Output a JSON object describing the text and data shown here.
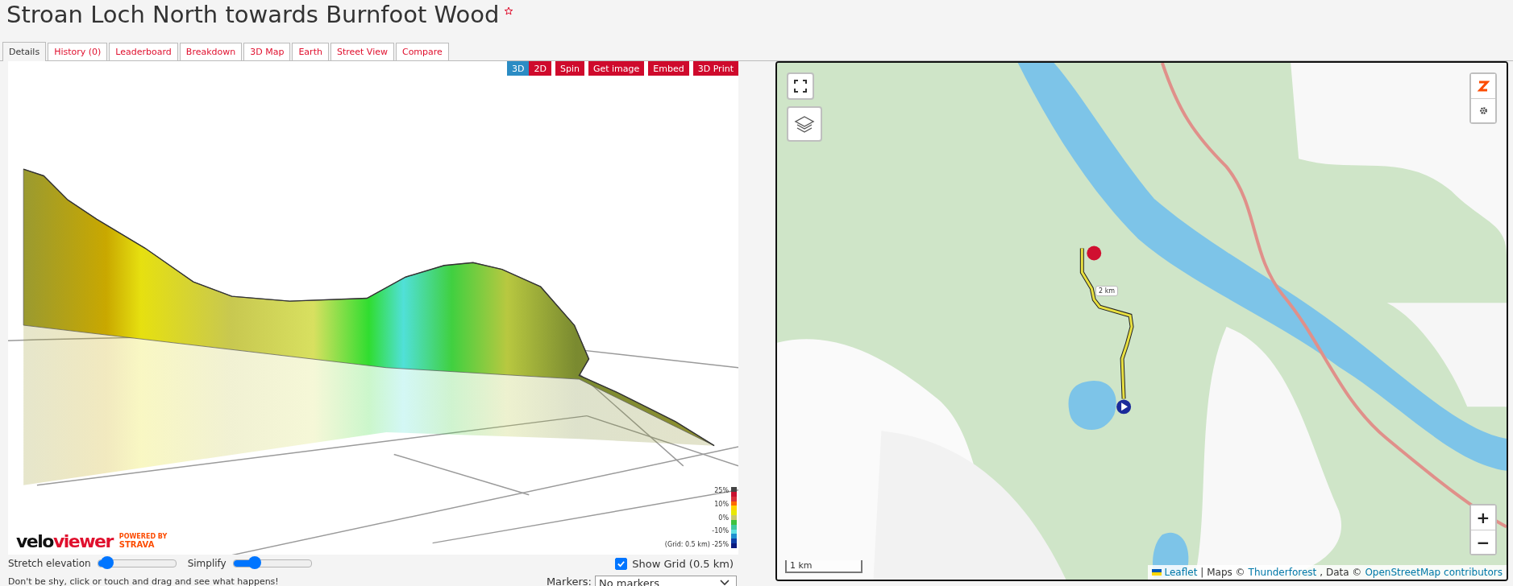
{
  "title": "Stroan Loch North towards Burnfoot Wood",
  "tabs": [
    {
      "label": "Details",
      "selected": true
    },
    {
      "label": "History (0)",
      "selected": false
    },
    {
      "label": "Leaderboard",
      "selected": false
    },
    {
      "label": "Breakdown",
      "selected": false
    },
    {
      "label": "3D Map",
      "selected": false
    },
    {
      "label": "Earth",
      "selected": false
    },
    {
      "label": "Street View",
      "selected": false
    },
    {
      "label": "Compare",
      "selected": false
    }
  ],
  "view_modes": [
    {
      "label": "3D",
      "selected": true
    },
    {
      "label": "2D",
      "selected": false
    }
  ],
  "actions": [
    "Spin",
    "Get image",
    "Embed",
    "3D Print"
  ],
  "legend_labels": [
    "25%",
    "10%",
    "0%",
    "-10%",
    "(Grid: 0.5 km) -25%"
  ],
  "logo": {
    "part_1": "velo",
    "part_2": "viewer",
    "powered_by": "POWERED BY",
    "partner": "STRAVA"
  },
  "sliders": [
    {
      "label": "Stretch elevation",
      "level": 0.12
    },
    {
      "label": "Simplify",
      "level": 0.27
    }
  ],
  "show_grid": {
    "label": "Show Grid (0.5 km)",
    "checked": true
  },
  "hint": "Don't be shy, click or touch and drag and see what happens!",
  "markers": {
    "label": "Markers:",
    "value": "No markers"
  },
  "map": {
    "route_label": "2 km",
    "scale": "1 km",
    "zoom_in": "+",
    "zoom_out": "−",
    "attribution": [
      {
        "kind": "link",
        "text": "Leaflet"
      },
      {
        "kind": "text",
        "text": "| Maps ©"
      },
      {
        "kind": "link",
        "text": "Thunderforest"
      },
      {
        "kind": "text",
        "text": ", Data ©"
      },
      {
        "kind": "link",
        "text": "OpenStreetMap contributors"
      }
    ]
  }
}
